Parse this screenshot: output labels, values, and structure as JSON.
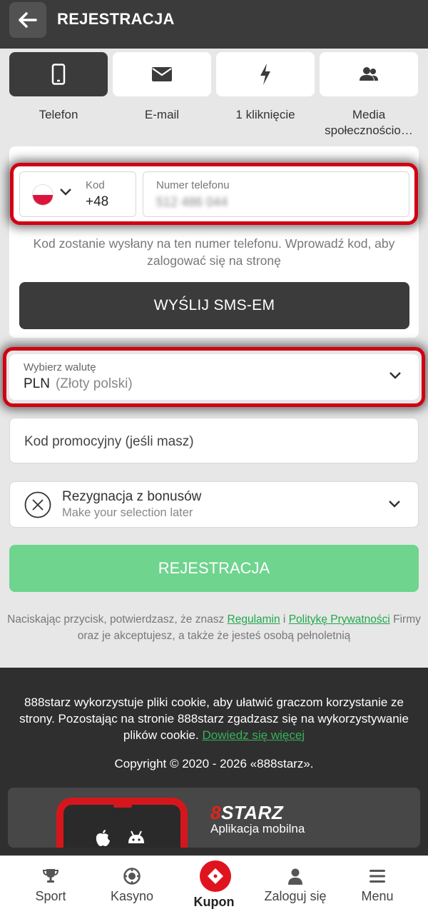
{
  "header": {
    "title": "REJESTRACJA"
  },
  "tabs": [
    {
      "label": "Telefon",
      "icon": "phone-icon",
      "active": true
    },
    {
      "label": "E-mail",
      "icon": "envelope-icon",
      "active": false
    },
    {
      "label": "1 kliknięcie",
      "icon": "lightning-icon",
      "active": false
    },
    {
      "label": "Media społecznościo…",
      "icon": "users-icon",
      "active": false
    }
  ],
  "phone": {
    "code_label": "Kod",
    "code_value": "+48",
    "number_label": "Numer telefonu",
    "number_value": "512 486 044",
    "info_text": "Kod zostanie wysłany na ten numer telefonu. Wprowadź kod, aby zalogować się na stronę",
    "send_button": "WYŚLIJ SMS-EM"
  },
  "currency": {
    "label": "Wybierz walutę",
    "code": "PLN",
    "name": "(Złoty polski)"
  },
  "promo": {
    "placeholder": "Kod promocyjny (jeśli masz)"
  },
  "bonus": {
    "title": "Rezygnacja z bonusów",
    "subtitle": "Make your selection later"
  },
  "register_button": "REJESTRACJA",
  "terms": {
    "prefix": "Naciskając przycisk, potwierdzasz, że znasz ",
    "link1": "Regulamin",
    "middle": " i ",
    "link2": "Politykę Prywatności",
    "suffix": " Firmy oraz je akceptujesz, a także że jesteś osobą pełnoletnią"
  },
  "footer": {
    "cookie_text": "888starz wykorzystuje pliki cookie, aby ułatwić graczom korzystanie ze strony. Pozostając na stronie 888starz zgadzasz się na wykorzystywanie plików cookie.",
    "cookie_link": "Dowiedz się więcej",
    "copyright": "Copyright © 2020 - 2026 «888starz».",
    "brand_prefix": "8",
    "brand_name": "STARZ",
    "app_label": "Aplikacja mobilna"
  },
  "bottom_nav": [
    {
      "label": "Sport",
      "icon": "trophy-icon"
    },
    {
      "label": "Kasyno",
      "icon": "casino-chip-icon"
    },
    {
      "label": "Kupon",
      "icon": "coupon-icon"
    },
    {
      "label": "Zaloguj się",
      "icon": "user-icon"
    },
    {
      "label": "Menu",
      "icon": "menu-icon"
    }
  ],
  "colors": {
    "accent_green": "#6fd48d",
    "highlight_red": "#d10012",
    "dark": "#3b3b3b",
    "brand_red": "#e0141e"
  }
}
